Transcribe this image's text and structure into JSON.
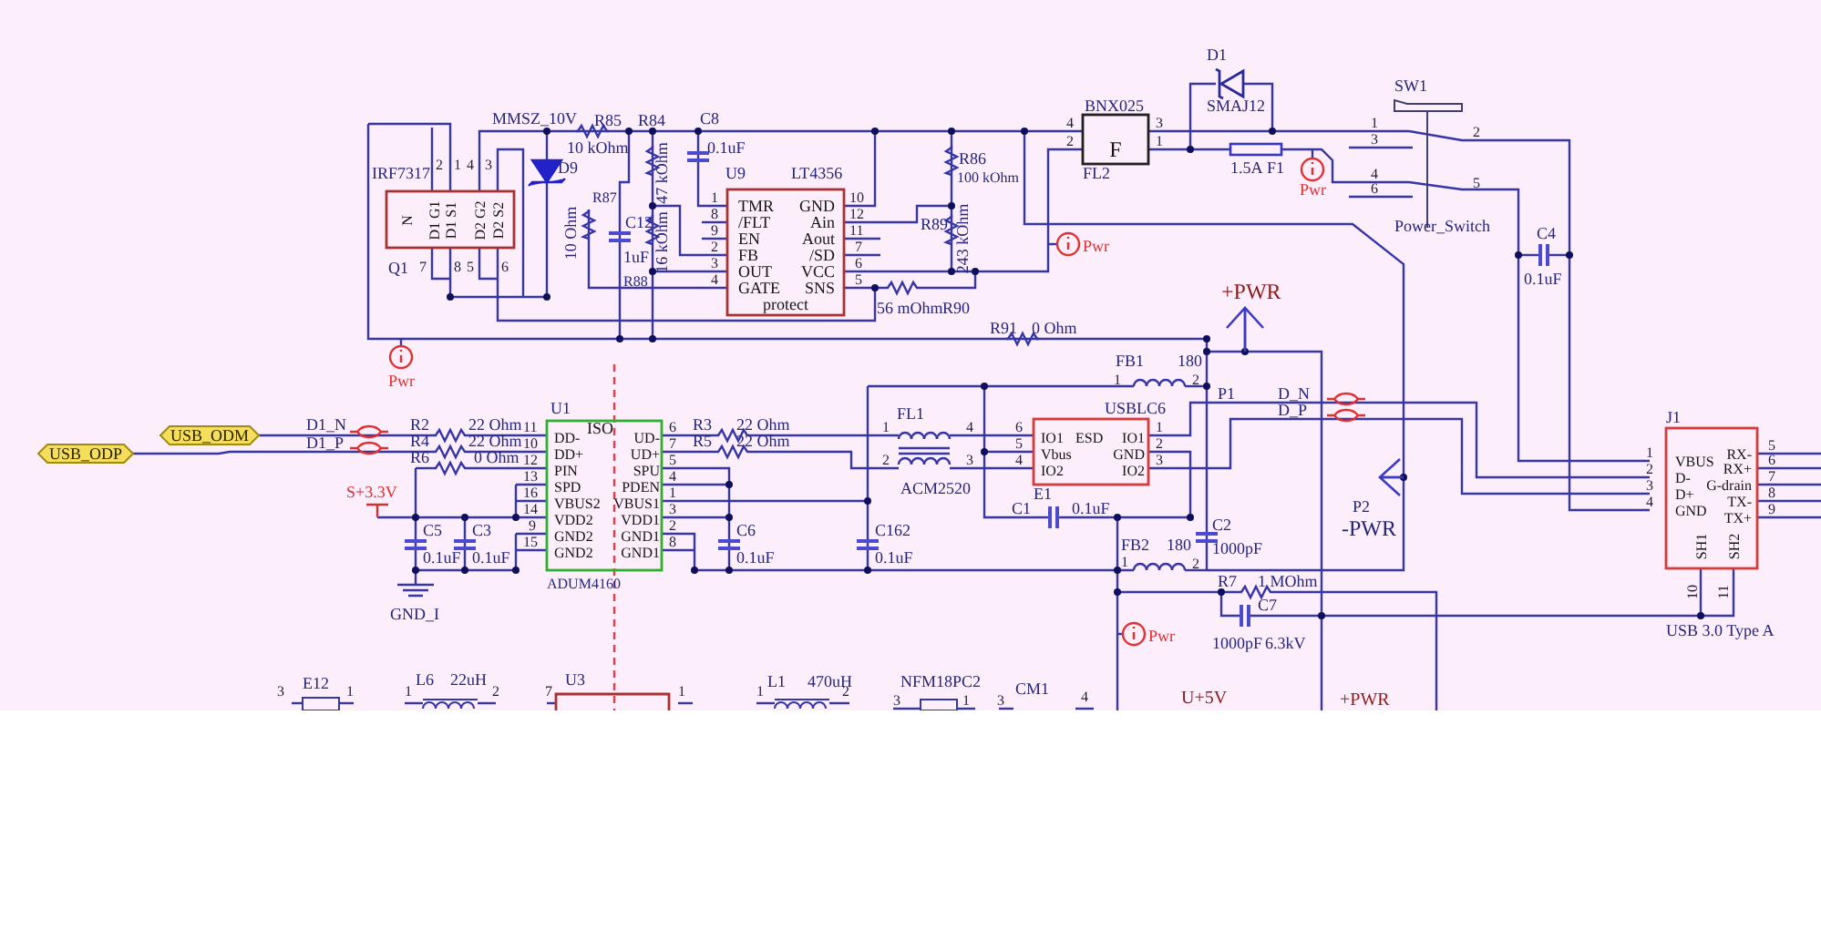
{
  "schematic": {
    "labels": [
      {
        "kind": "value",
        "text": "MMSZ_10V"
      },
      {
        "kind": "ref",
        "text": "R85"
      },
      {
        "kind": "ref",
        "text": "R84"
      },
      {
        "kind": "ref",
        "text": "C8"
      },
      {
        "kind": "value",
        "text": "IRF7317"
      },
      {
        "kind": "ref",
        "text": "Q1"
      },
      {
        "kind": "pin",
        "text": "2"
      },
      {
        "kind": "pin",
        "text": "1"
      },
      {
        "kind": "pin",
        "text": "4"
      },
      {
        "kind": "pin",
        "text": "3"
      },
      {
        "kind": "pin",
        "text": "7"
      },
      {
        "kind": "pin",
        "text": "8"
      },
      {
        "kind": "pin",
        "text": "5"
      },
      {
        "kind": "pin",
        "text": "6"
      },
      {
        "kind": "pin-name",
        "text": "N"
      },
      {
        "kind": "pin-name",
        "text": "D1 G1"
      },
      {
        "kind": "pin-name",
        "text": "D1 S1"
      },
      {
        "kind": "pin-name",
        "text": "D2 G2"
      },
      {
        "kind": "pin-name",
        "text": "D2 S2"
      },
      {
        "kind": "ref",
        "text": "D9"
      },
      {
        "kind": "value",
        "text": "10 kOhm"
      },
      {
        "kind": "ref",
        "text": "R87"
      },
      {
        "kind": "value",
        "text": "10 Ohm"
      },
      {
        "kind": "value",
        "text": "47 kOhm"
      },
      {
        "kind": "ref",
        "text": "C12"
      },
      {
        "kind": "value",
        "text": "1uF"
      },
      {
        "kind": "value",
        "text": "16 kOhm"
      },
      {
        "kind": "ref",
        "text": "R88"
      },
      {
        "kind": "value",
        "text": "0.1uF"
      },
      {
        "kind": "ref",
        "text": "U9"
      },
      {
        "kind": "value",
        "text": "LT4356"
      },
      {
        "kind": "pin",
        "text": "1"
      },
      {
        "kind": "pin",
        "text": "8"
      },
      {
        "kind": "pin",
        "text": "9"
      },
      {
        "kind": "pin",
        "text": "2"
      },
      {
        "kind": "pin",
        "text": "3"
      },
      {
        "kind": "pin",
        "text": "4"
      },
      {
        "kind": "pin-name",
        "text": "TMR"
      },
      {
        "kind": "pin-name",
        "text": "/FLT"
      },
      {
        "kind": "pin-name",
        "text": "EN"
      },
      {
        "kind": "pin-name",
        "text": "FB"
      },
      {
        "kind": "pin-name",
        "text": "OUT"
      },
      {
        "kind": "pin-name",
        "text": "GATE"
      },
      {
        "kind": "pin-name",
        "text": "GND"
      },
      {
        "kind": "pin-name",
        "text": "Ain"
      },
      {
        "kind": "pin-name",
        "text": "Aout"
      },
      {
        "kind": "pin-name",
        "text": "/SD"
      },
      {
        "kind": "pin-name",
        "text": "VCC"
      },
      {
        "kind": "pin-name",
        "text": "SNS"
      },
      {
        "kind": "pin",
        "text": "10"
      },
      {
        "kind": "pin",
        "text": "12"
      },
      {
        "kind": "pin",
        "text": "11"
      },
      {
        "kind": "pin",
        "text": "7"
      },
      {
        "kind": "pin",
        "text": "6"
      },
      {
        "kind": "pin",
        "text": "5"
      },
      {
        "kind": "pin-name",
        "text": "protect"
      },
      {
        "kind": "value",
        "text": "56 mOhm"
      },
      {
        "kind": "ref",
        "text": "R90"
      },
      {
        "kind": "ref",
        "text": "R86"
      },
      {
        "kind": "value",
        "text": "100 kOhm"
      },
      {
        "kind": "ref",
        "text": "R89"
      },
      {
        "kind": "value",
        "text": "243 kOhm"
      },
      {
        "kind": "value",
        "text": "BNX025"
      },
      {
        "kind": "pin",
        "text": "4"
      },
      {
        "kind": "pin",
        "text": "2"
      },
      {
        "kind": "pin",
        "text": "3"
      },
      {
        "kind": "pin",
        "text": "1"
      },
      {
        "kind": "pin-name",
        "text": "F"
      },
      {
        "kind": "ref",
        "text": "FL2"
      },
      {
        "kind": "ref",
        "text": "D1"
      },
      {
        "kind": "value",
        "text": "SMAJ12"
      },
      {
        "kind": "value",
        "text": "1.5A"
      },
      {
        "kind": "ref",
        "text": "F1"
      },
      {
        "kind": "ref",
        "text": "SW1"
      },
      {
        "kind": "pin",
        "text": "1"
      },
      {
        "kind": "pin",
        "text": "3"
      },
      {
        "kind": "pin",
        "text": "4"
      },
      {
        "kind": "pin",
        "text": "6"
      },
      {
        "kind": "pin",
        "text": "2"
      },
      {
        "kind": "pin",
        "text": "5"
      },
      {
        "kind": "value",
        "text": "Power_Switch"
      },
      {
        "kind": "ref",
        "text": "C4"
      },
      {
        "kind": "value",
        "text": "0.1uF"
      },
      {
        "kind": "power",
        "text": "+PWR"
      },
      {
        "kind": "ref",
        "text": "R91"
      },
      {
        "kind": "value",
        "text": "0 Ohm"
      },
      {
        "kind": "net",
        "text": "D1_N"
      },
      {
        "kind": "net",
        "text": "D1_P"
      },
      {
        "kind": "ref",
        "text": "R2"
      },
      {
        "kind": "value",
        "text": "22 Ohm"
      },
      {
        "kind": "ref",
        "text": "R4"
      },
      {
        "kind": "value",
        "text": "22 Ohm"
      },
      {
        "kind": "ref",
        "text": "R6"
      },
      {
        "kind": "value",
        "text": "0 Ohm"
      },
      {
        "kind": "ref",
        "text": "U1"
      },
      {
        "kind": "pin",
        "text": "11"
      },
      {
        "kind": "pin-name",
        "text": "ISO"
      },
      {
        "kind": "pin",
        "text": "10"
      },
      {
        "kind": "pin",
        "text": "12"
      },
      {
        "kind": "pin",
        "text": "13"
      },
      {
        "kind": "pin",
        "text": "16"
      },
      {
        "kind": "pin",
        "text": "14"
      },
      {
        "kind": "pin",
        "text": "9"
      },
      {
        "kind": "pin",
        "text": "15"
      },
      {
        "kind": "pin-name",
        "text": "DD-"
      },
      {
        "kind": "pin-name",
        "text": "DD+"
      },
      {
        "kind": "pin-name",
        "text": "PIN"
      },
      {
        "kind": "pin-name",
        "text": "SPD"
      },
      {
        "kind": "pin-name",
        "text": "VBUS2"
      },
      {
        "kind": "pin-name",
        "text": "VDD2"
      },
      {
        "kind": "pin-name",
        "text": "GND2"
      },
      {
        "kind": "pin-name",
        "text": "GND2"
      },
      {
        "kind": "pin-name",
        "text": "UD-"
      },
      {
        "kind": "pin-name",
        "text": "UD+"
      },
      {
        "kind": "pin-name",
        "text": "SPU"
      },
      {
        "kind": "pin-name",
        "text": "PDEN"
      },
      {
        "kind": "pin-name",
        "text": "VBUS1"
      },
      {
        "kind": "pin-name",
        "text": "VDD1"
      },
      {
        "kind": "pin-name",
        "text": "GND1"
      },
      {
        "kind": "pin-name",
        "text": "GND1"
      },
      {
        "kind": "pin",
        "text": "6"
      },
      {
        "kind": "pin",
        "text": "7"
      },
      {
        "kind": "pin",
        "text": "5"
      },
      {
        "kind": "pin",
        "text": "4"
      },
      {
        "kind": "pin",
        "text": "1"
      },
      {
        "kind": "pin",
        "text": "3"
      },
      {
        "kind": "pin",
        "text": "2"
      },
      {
        "kind": "pin",
        "text": "8"
      },
      {
        "kind": "value",
        "text": "ADUM4160"
      },
      {
        "kind": "rail",
        "text": "S+3.3V"
      },
      {
        "kind": "ref",
        "text": "C5"
      },
      {
        "kind": "value",
        "text": "0.1uF"
      },
      {
        "kind": "ref",
        "text": "C3"
      },
      {
        "kind": "value",
        "text": "0.1uF"
      },
      {
        "kind": "net",
        "text": "GND_I"
      },
      {
        "kind": "ref",
        "text": "R3"
      },
      {
        "kind": "value",
        "text": "22 Ohm"
      },
      {
        "kind": "ref",
        "text": "R5"
      },
      {
        "kind": "value",
        "text": "22 Ohm"
      },
      {
        "kind": "ref",
        "text": "C6"
      },
      {
        "kind": "value",
        "text": "0.1uF"
      },
      {
        "kind": "ref",
        "text": "C162"
      },
      {
        "kind": "value",
        "text": "0.1uF"
      },
      {
        "kind": "ref",
        "text": "FL1"
      },
      {
        "kind": "pin",
        "text": "1"
      },
      {
        "kind": "pin",
        "text": "4"
      },
      {
        "kind": "pin",
        "text": "2"
      },
      {
        "kind": "pin",
        "text": "3"
      },
      {
        "kind": "value",
        "text": "ACM2520"
      },
      {
        "kind": "value",
        "text": "USBLC6"
      },
      {
        "kind": "pin",
        "text": "6"
      },
      {
        "kind": "pin",
        "text": "5"
      },
      {
        "kind": "pin",
        "text": "4"
      },
      {
        "kind": "pin-name",
        "text": "IO1"
      },
      {
        "kind": "pin-name",
        "text": "Vbus"
      },
      {
        "kind": "pin-name",
        "text": "IO2"
      },
      {
        "kind": "pin-name",
        "text": "ESD"
      },
      {
        "kind": "pin-name",
        "text": "IO1"
      },
      {
        "kind": "pin-name",
        "text": "GND"
      },
      {
        "kind": "pin-name",
        "text": "IO2"
      },
      {
        "kind": "pin",
        "text": "1"
      },
      {
        "kind": "pin",
        "text": "2"
      },
      {
        "kind": "pin",
        "text": "3"
      },
      {
        "kind": "ref",
        "text": "E1"
      },
      {
        "kind": "ref",
        "text": "C1"
      },
      {
        "kind": "value",
        "text": "0.1uF"
      },
      {
        "kind": "ref",
        "text": "FB1"
      },
      {
        "kind": "value",
        "text": "180"
      },
      {
        "kind": "pin",
        "text": "1"
      },
      {
        "kind": "pin",
        "text": "2"
      },
      {
        "kind": "ref",
        "text": "FB2"
      },
      {
        "kind": "value",
        "text": "180"
      },
      {
        "kind": "pin",
        "text": "1"
      },
      {
        "kind": "pin",
        "text": "2"
      },
      {
        "kind": "ref",
        "text": "P1"
      },
      {
        "kind": "net",
        "text": "D_N"
      },
      {
        "kind": "net",
        "text": "D_P"
      },
      {
        "kind": "ref",
        "text": "C2"
      },
      {
        "kind": "value",
        "text": "1000pF"
      },
      {
        "kind": "ref",
        "text": "P2"
      },
      {
        "kind": "net",
        "text": "-PWR"
      },
      {
        "kind": "ref",
        "text": "R7"
      },
      {
        "kind": "value",
        "text": "1 MOhm"
      },
      {
        "kind": "ref",
        "text": "C7"
      },
      {
        "kind": "value",
        "text": "1000pF"
      },
      {
        "kind": "value",
        "text": "6.3kV"
      },
      {
        "kind": "ref",
        "text": "J1"
      },
      {
        "kind": "pin",
        "text": "1"
      },
      {
        "kind": "pin",
        "text": "2"
      },
      {
        "kind": "pin",
        "text": "3"
      },
      {
        "kind": "pin",
        "text": "4"
      },
      {
        "kind": "pin-name",
        "text": "VBUS"
      },
      {
        "kind": "pin-name",
        "text": "D-"
      },
      {
        "kind": "pin-name",
        "text": "D+"
      },
      {
        "kind": "pin-name",
        "text": "GND"
      },
      {
        "kind": "pin-name",
        "text": "RX-"
      },
      {
        "kind": "pin-name",
        "text": "RX+"
      },
      {
        "kind": "pin-name",
        "text": "G-drain"
      },
      {
        "kind": "pin-name",
        "text": "TX-"
      },
      {
        "kind": "pin-name",
        "text": "TX+"
      },
      {
        "kind": "pin",
        "text": "5"
      },
      {
        "kind": "pin",
        "text": "6"
      },
      {
        "kind": "pin",
        "text": "7"
      },
      {
        "kind": "pin",
        "text": "8"
      },
      {
        "kind": "pin",
        "text": "9"
      },
      {
        "kind": "pin-name",
        "text": "SH1"
      },
      {
        "kind": "pin-name",
        "text": "SH2"
      },
      {
        "kind": "pin",
        "text": "10"
      },
      {
        "kind": "pin",
        "text": "11"
      },
      {
        "kind": "value",
        "text": "USB 3.0 Type A"
      },
      {
        "kind": "pin",
        "text": "3"
      },
      {
        "kind": "ref",
        "text": "E12"
      },
      {
        "kind": "pin",
        "text": "1"
      },
      {
        "kind": "pin",
        "text": "1"
      },
      {
        "kind": "ref",
        "text": "L6"
      },
      {
        "kind": "value",
        "text": "22uH"
      },
      {
        "kind": "pin",
        "text": "2"
      },
      {
        "kind": "pin",
        "text": "7"
      },
      {
        "kind": "ref",
        "text": "U3"
      },
      {
        "kind": "pin",
        "text": "1"
      },
      {
        "kind": "pin",
        "text": "1"
      },
      {
        "kind": "ref",
        "text": "L1"
      },
      {
        "kind": "value",
        "text": "470uH"
      },
      {
        "kind": "pin",
        "text": "2"
      },
      {
        "kind": "value",
        "text": "NFM18PC2"
      },
      {
        "kind": "pin",
        "text": "3"
      },
      {
        "kind": "pin",
        "text": "1"
      },
      {
        "kind": "pin",
        "text": "3"
      },
      {
        "kind": "ref",
        "text": "CM1"
      },
      {
        "kind": "pin",
        "text": "4"
      },
      {
        "kind": "power",
        "text": "U+5V"
      },
      {
        "kind": "power",
        "text": "+PWR"
      }
    ]
  },
  "ports": [
    {
      "text": "USB_ODM"
    },
    {
      "text": "USB_ODP"
    }
  ],
  "power_flags": [
    {
      "text": "Pwr"
    },
    {
      "text": "Pwr"
    },
    {
      "text": "Pwr"
    },
    {
      "text": "Pwr"
    }
  ]
}
